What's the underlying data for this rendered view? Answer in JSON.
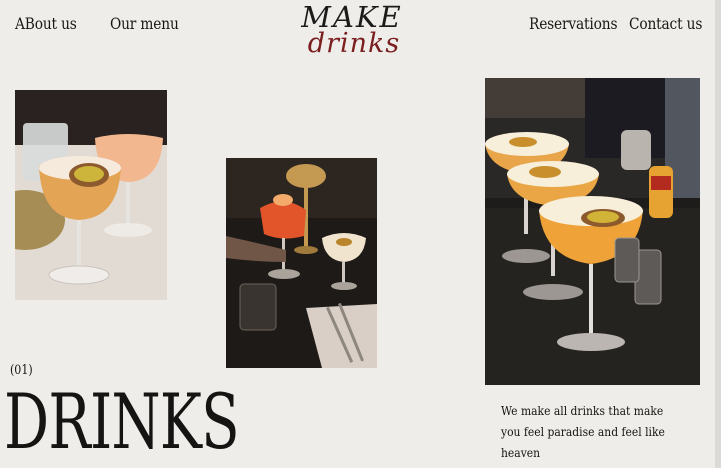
{
  "nav": {
    "about_label": "ABout us",
    "menu_label": "Our menu",
    "reservations_label": "Reservations",
    "contact_label": "Contact us"
  },
  "logo": {
    "line1": "MAKE",
    "line2": "drinks",
    "accent_color": "#7a1f1f"
  },
  "section": {
    "counter": "(01)",
    "heading": "DRINKS"
  },
  "tagline": "We make all drinks that make you feel paradise and feel like heaven",
  "colors": {
    "background": "#efedea",
    "text": "#161412"
  }
}
